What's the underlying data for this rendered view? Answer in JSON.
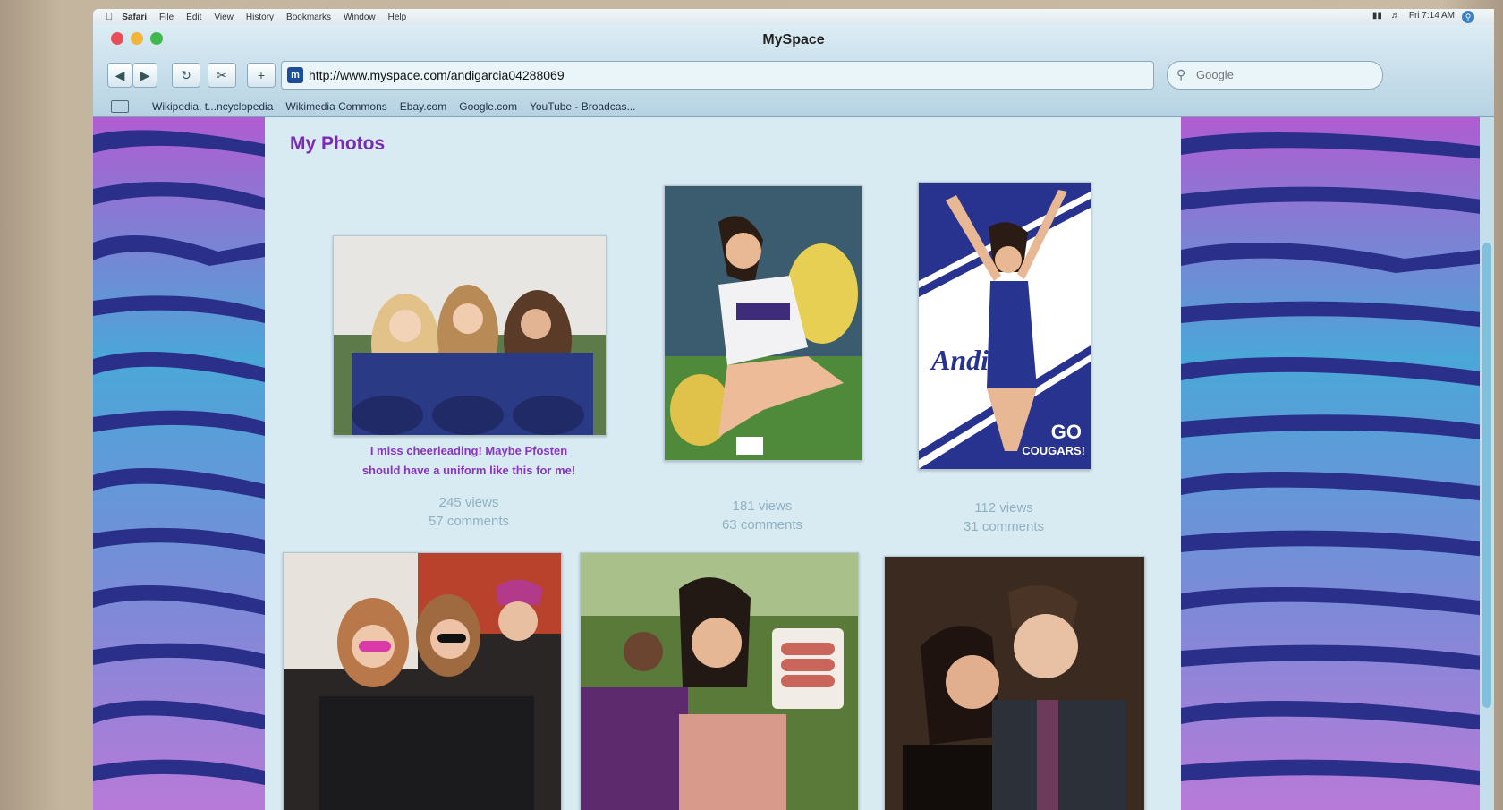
{
  "menubar": {
    "items": [
      "Safari",
      "File",
      "Edit",
      "View",
      "History",
      "Bookmarks",
      "Window",
      "Help"
    ],
    "clock": "Fri 7:14 AM"
  },
  "window": {
    "title": "MySpace"
  },
  "toolbar": {
    "url": "http://www.myspace.com/andigarcia04288069",
    "search_placeholder": "Google"
  },
  "bookmarks": [
    "Wikipedia, t...ncyclopedia",
    "Wikimedia Commons",
    "Ebay.com",
    "Google.com",
    "YouTube - Broadcas..."
  ],
  "page": {
    "section_title": "My Photos",
    "photos": [
      {
        "caption_line1": "I miss cheerleading! Maybe Pfosten",
        "caption_line2": "should have a uniform like this for me!",
        "views": "245 views",
        "comments": "57 comments"
      },
      {
        "views": "181 views",
        "comments": "63 comments"
      },
      {
        "views": "112 views",
        "comments": "31 comments",
        "poster_name": "Andi",
        "poster_go": "GO",
        "poster_team": "COUGARS!"
      }
    ]
  },
  "colors": {
    "accent_purple": "#8a35c2",
    "title_purple": "#7b2bb3",
    "zebra_dark": "#2a2f8a"
  }
}
